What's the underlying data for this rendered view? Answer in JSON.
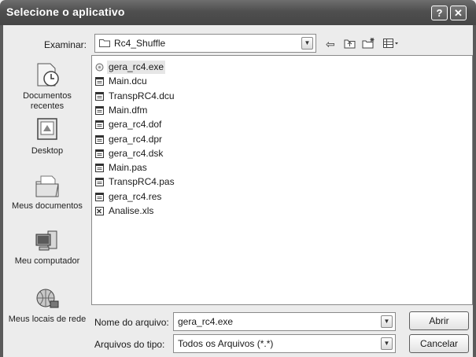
{
  "window": {
    "title": "Selecione o aplicativo",
    "help_label": "?",
    "close_label": "✕"
  },
  "lookin": {
    "label": "Examinar:",
    "value": "Rc4_Shuffle",
    "dropdown_glyph": "▼"
  },
  "toolbar": {
    "back_glyph": "⇦",
    "up_glyph": "🗈",
    "newfolder_glyph": "🗋",
    "views_glyph": "▦▾"
  },
  "places": {
    "recent": "Documentos recentes",
    "desktop": "Desktop",
    "documents": "Meus documentos",
    "computer": "Meu computador",
    "network": "Meus locais de rede"
  },
  "files": [
    {
      "name": "gera_rc4.exe",
      "icon": "exe-icon",
      "selected": true
    },
    {
      "name": "Main.dcu",
      "icon": "generic-file-icon"
    },
    {
      "name": "TranspRC4.dcu",
      "icon": "generic-file-icon"
    },
    {
      "name": "Main.dfm",
      "icon": "generic-file-icon"
    },
    {
      "name": "gera_rc4.dof",
      "icon": "generic-file-icon"
    },
    {
      "name": "gera_rc4.dpr",
      "icon": "generic-file-icon"
    },
    {
      "name": "gera_rc4.dsk",
      "icon": "generic-file-icon"
    },
    {
      "name": "Main.pas",
      "icon": "generic-file-icon"
    },
    {
      "name": "TranspRC4.pas",
      "icon": "generic-file-icon"
    },
    {
      "name": "gera_rc4.res",
      "icon": "generic-file-icon"
    },
    {
      "name": "Analise.xls",
      "icon": "excel-icon"
    }
  ],
  "filename": {
    "label": "Nome do arquivo:",
    "value": "gera_rc4.exe"
  },
  "filetype": {
    "label": "Arquivos do tipo:",
    "value": "Todos os Arquivos (*.*)"
  },
  "buttons": {
    "open": "Abrir",
    "cancel": "Cancelar"
  }
}
